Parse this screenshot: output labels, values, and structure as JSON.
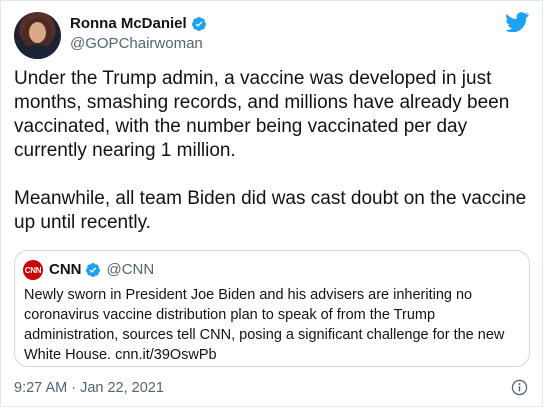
{
  "author": {
    "name": "Ronna McDaniel",
    "handle": "@GOPChairwoman"
  },
  "tweet": {
    "text": "Under the Trump admin, a vaccine was developed in just months, smashing records, and millions have already been vaccinated, with the number being vaccinated per day currently nearing 1 million.\n\nMeanwhile, all team Biden did was cast doubt on the vaccine up until recently.",
    "timestamp": "9:27 AM · Jan 22, 2021"
  },
  "quoted": {
    "logo_text": "CNN",
    "name": "CNN",
    "handle": "@CNN",
    "text": "Newly sworn in President Joe Biden and his advisers are inheriting no coronavirus vaccine distribution plan to speak of from the Trump administration, sources tell CNN, posing a significant challenge for the new White House. cnn.it/39OswPb"
  },
  "icons": {
    "verified": "verified-badge-icon",
    "brand": "twitter-bird-icon",
    "info": "info-icon"
  },
  "colors": {
    "brand": "#1da1f2",
    "cnn_red": "#cc0000",
    "secondary_text": "#536471"
  }
}
